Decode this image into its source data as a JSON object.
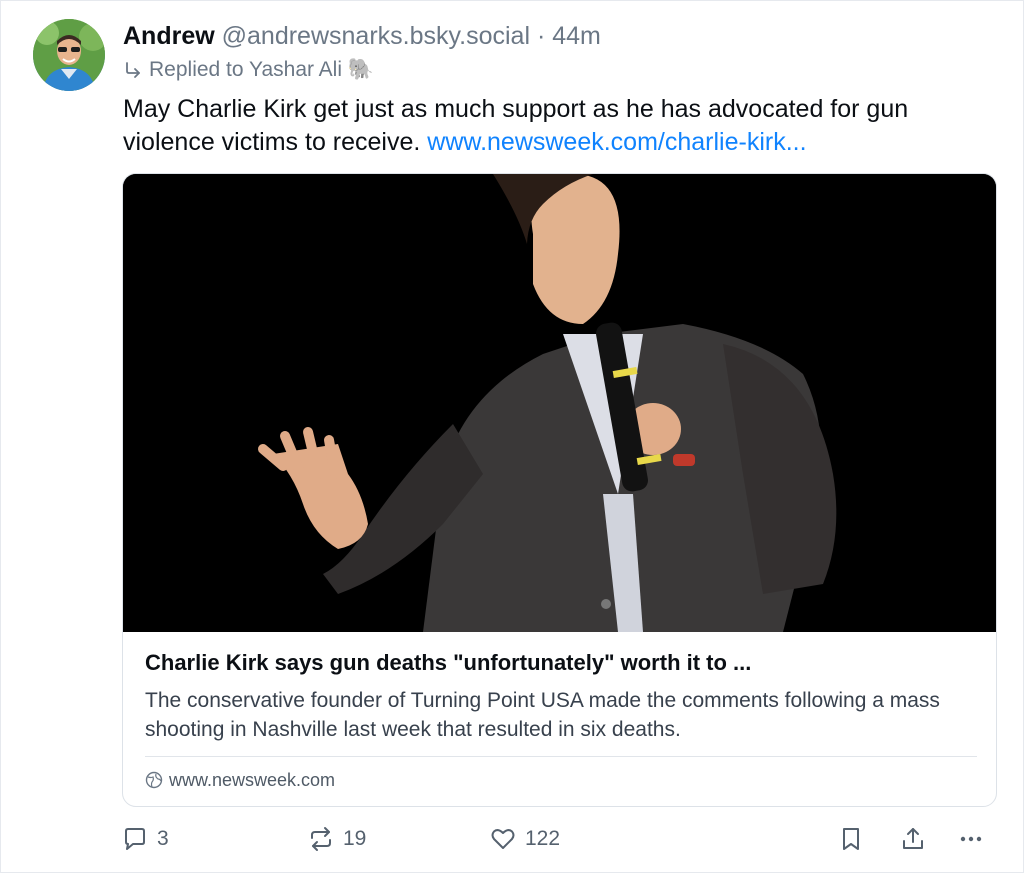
{
  "author": {
    "display_name": "Andrew",
    "handle": "@andrewsnarks.bsky.social",
    "separator": "·",
    "time": "44m"
  },
  "reply_context": {
    "text": "Replied to Yashar Ali 🐘"
  },
  "post": {
    "text": "May Charlie Kirk get just as much support as he has advocated for gun violence victims to receive. ",
    "link_text": "www.newsweek.com/charlie-kirk..."
  },
  "card": {
    "title": "Charlie Kirk says gun deaths \"unfortunately\" worth it to ...",
    "description": "The conservative founder of Turning Point USA made the comments following a mass shooting in Nashville last week that resulted in six deaths.",
    "domain": "www.newsweek.com"
  },
  "actions": {
    "reply_count": "3",
    "repost_count": "19",
    "like_count": "122"
  },
  "colors": {
    "link": "#1083fe",
    "muted": "#6b7785",
    "icon": "#55616e"
  },
  "icons": [
    "avatar-photo",
    "reply-arrow-icon",
    "globe-icon",
    "reply-icon",
    "repost-icon",
    "like-icon",
    "bookmark-icon",
    "share-icon",
    "more-icon"
  ]
}
